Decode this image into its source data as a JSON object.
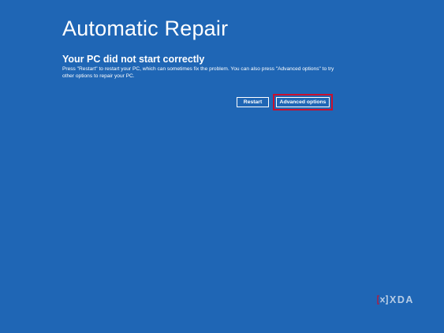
{
  "screen": {
    "title": "Automatic Repair",
    "subtitle": "Your PC did not start correctly",
    "description": "Press \"Restart\" to restart your PC, which can sometimes fix the problem. You can also press \"Advanced options\" to try other options to repair your PC."
  },
  "buttons": {
    "restart_label": "Restart",
    "advanced_label": "Advanced options"
  },
  "watermark": {
    "text": "XDA",
    "icon": "xda-logo-icon"
  },
  "colors": {
    "background": "#1f66b5",
    "text": "#ffffff",
    "focus_highlight": "#c8102e"
  }
}
